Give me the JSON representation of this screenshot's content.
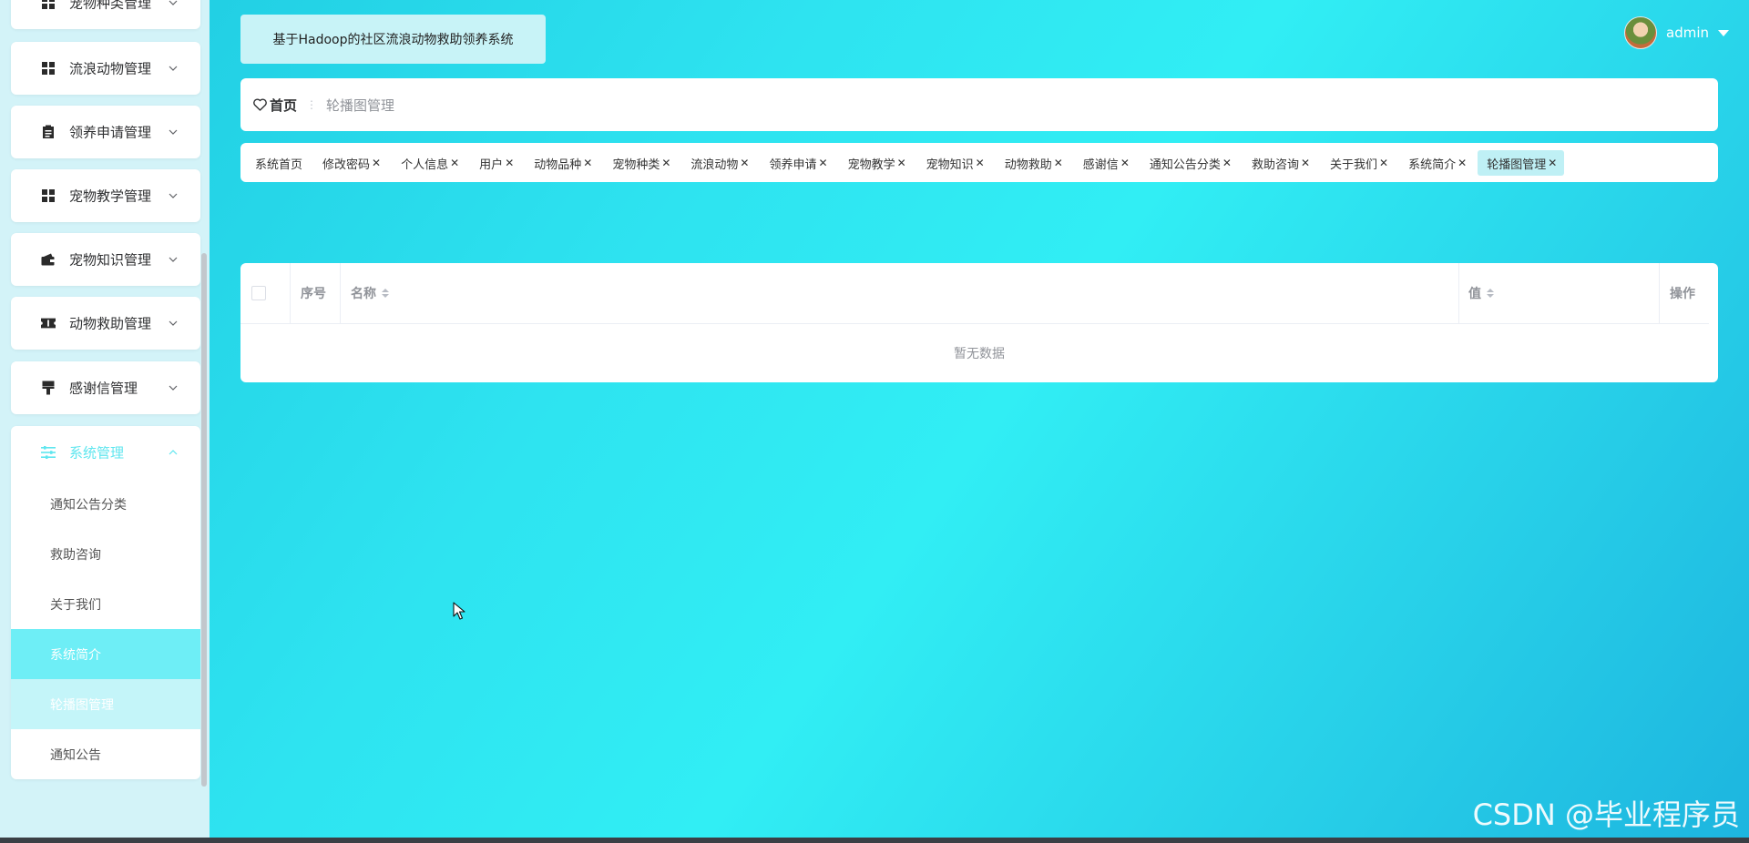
{
  "app_title": "基于Hadoop的社区流浪动物救助领养系统",
  "user": {
    "name": "admin"
  },
  "sidebar": {
    "menus": [
      {
        "label": "宠物种类管理",
        "icon": "grid-icon"
      },
      {
        "label": "流浪动物管理",
        "icon": "grid-icon"
      },
      {
        "label": "领养申请管理",
        "icon": "clipboard-icon"
      },
      {
        "label": "宠物教学管理",
        "icon": "grid-icon"
      },
      {
        "label": "宠物知识管理",
        "icon": "wallet-icon"
      },
      {
        "label": "动物救助管理",
        "icon": "ticket-icon"
      },
      {
        "label": "感谢信管理",
        "icon": "brush-icon"
      }
    ],
    "system_menu": {
      "label": "系统管理",
      "icon": "sliders-icon",
      "items": [
        "通知公告分类",
        "救助咨询",
        "关于我们",
        "系统简介",
        "轮播图管理",
        "通知公告"
      ]
    }
  },
  "breadcrumb": {
    "home": "首页",
    "current": "轮播图管理"
  },
  "tags": [
    "系统首页",
    "修改密码",
    "个人信息",
    "用户",
    "动物品种",
    "宠物种类",
    "流浪动物",
    "领养申请",
    "宠物教学",
    "宠物知识",
    "动物救助",
    "感谢信",
    "通知公告分类",
    "救助咨询",
    "关于我们",
    "系统简介",
    "轮播图管理"
  ],
  "table": {
    "columns": {
      "index": "序号",
      "name": "名称",
      "value": "值",
      "actions": "操作"
    },
    "empty_text": "暂无数据"
  },
  "watermark": "CSDN @毕业程序员",
  "colors": {
    "accent": "#5fe6ef",
    "active_item": "#6eeef6",
    "selected_item": "#c4f5f9",
    "active_tag": "#bff0f5"
  }
}
